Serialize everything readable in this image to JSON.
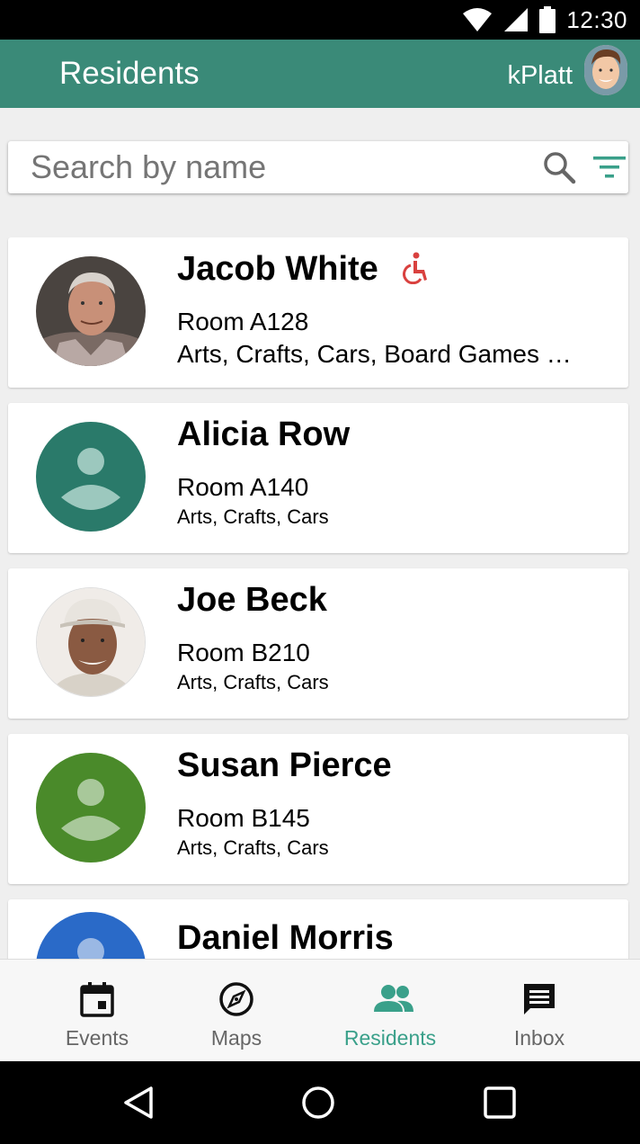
{
  "status_bar": {
    "time": "12:30"
  },
  "app_bar": {
    "title": "Residents",
    "username": "kPlatt"
  },
  "search": {
    "placeholder": "Search by name",
    "value": ""
  },
  "residents": [
    {
      "name": "Jacob White",
      "room": "Room A128",
      "interests": "Arts, Crafts, Cars, Board Games …",
      "avatar": "photo",
      "accessibility_icon": "wheelchair-icon"
    },
    {
      "name": "Alicia Row",
      "room": "Room A140",
      "interests": "Arts, Crafts, Cars",
      "avatar": "placeholder",
      "avatar_color": "#2a7a6a"
    },
    {
      "name": "Joe Beck",
      "room": "Room B210",
      "interests": "Arts, Crafts, Cars",
      "avatar": "photo"
    },
    {
      "name": "Susan Pierce",
      "room": "Room B145",
      "interests": "Arts, Crafts, Cars",
      "avatar": "placeholder",
      "avatar_color": "#4a8a2a"
    },
    {
      "name": "Daniel Morris",
      "avatar": "placeholder",
      "avatar_color": "#2a6ac8"
    }
  ],
  "bottom_nav": [
    {
      "label": "Events",
      "icon": "calendar-icon"
    },
    {
      "label": "Maps",
      "icon": "compass-icon"
    },
    {
      "label": "Residents",
      "icon": "people-icon",
      "active": true
    },
    {
      "label": "Inbox",
      "icon": "message-icon"
    }
  ],
  "colors": {
    "primary": "#3a8a78",
    "active_nav": "#3aa08a",
    "accessibility": "#d9413f"
  }
}
